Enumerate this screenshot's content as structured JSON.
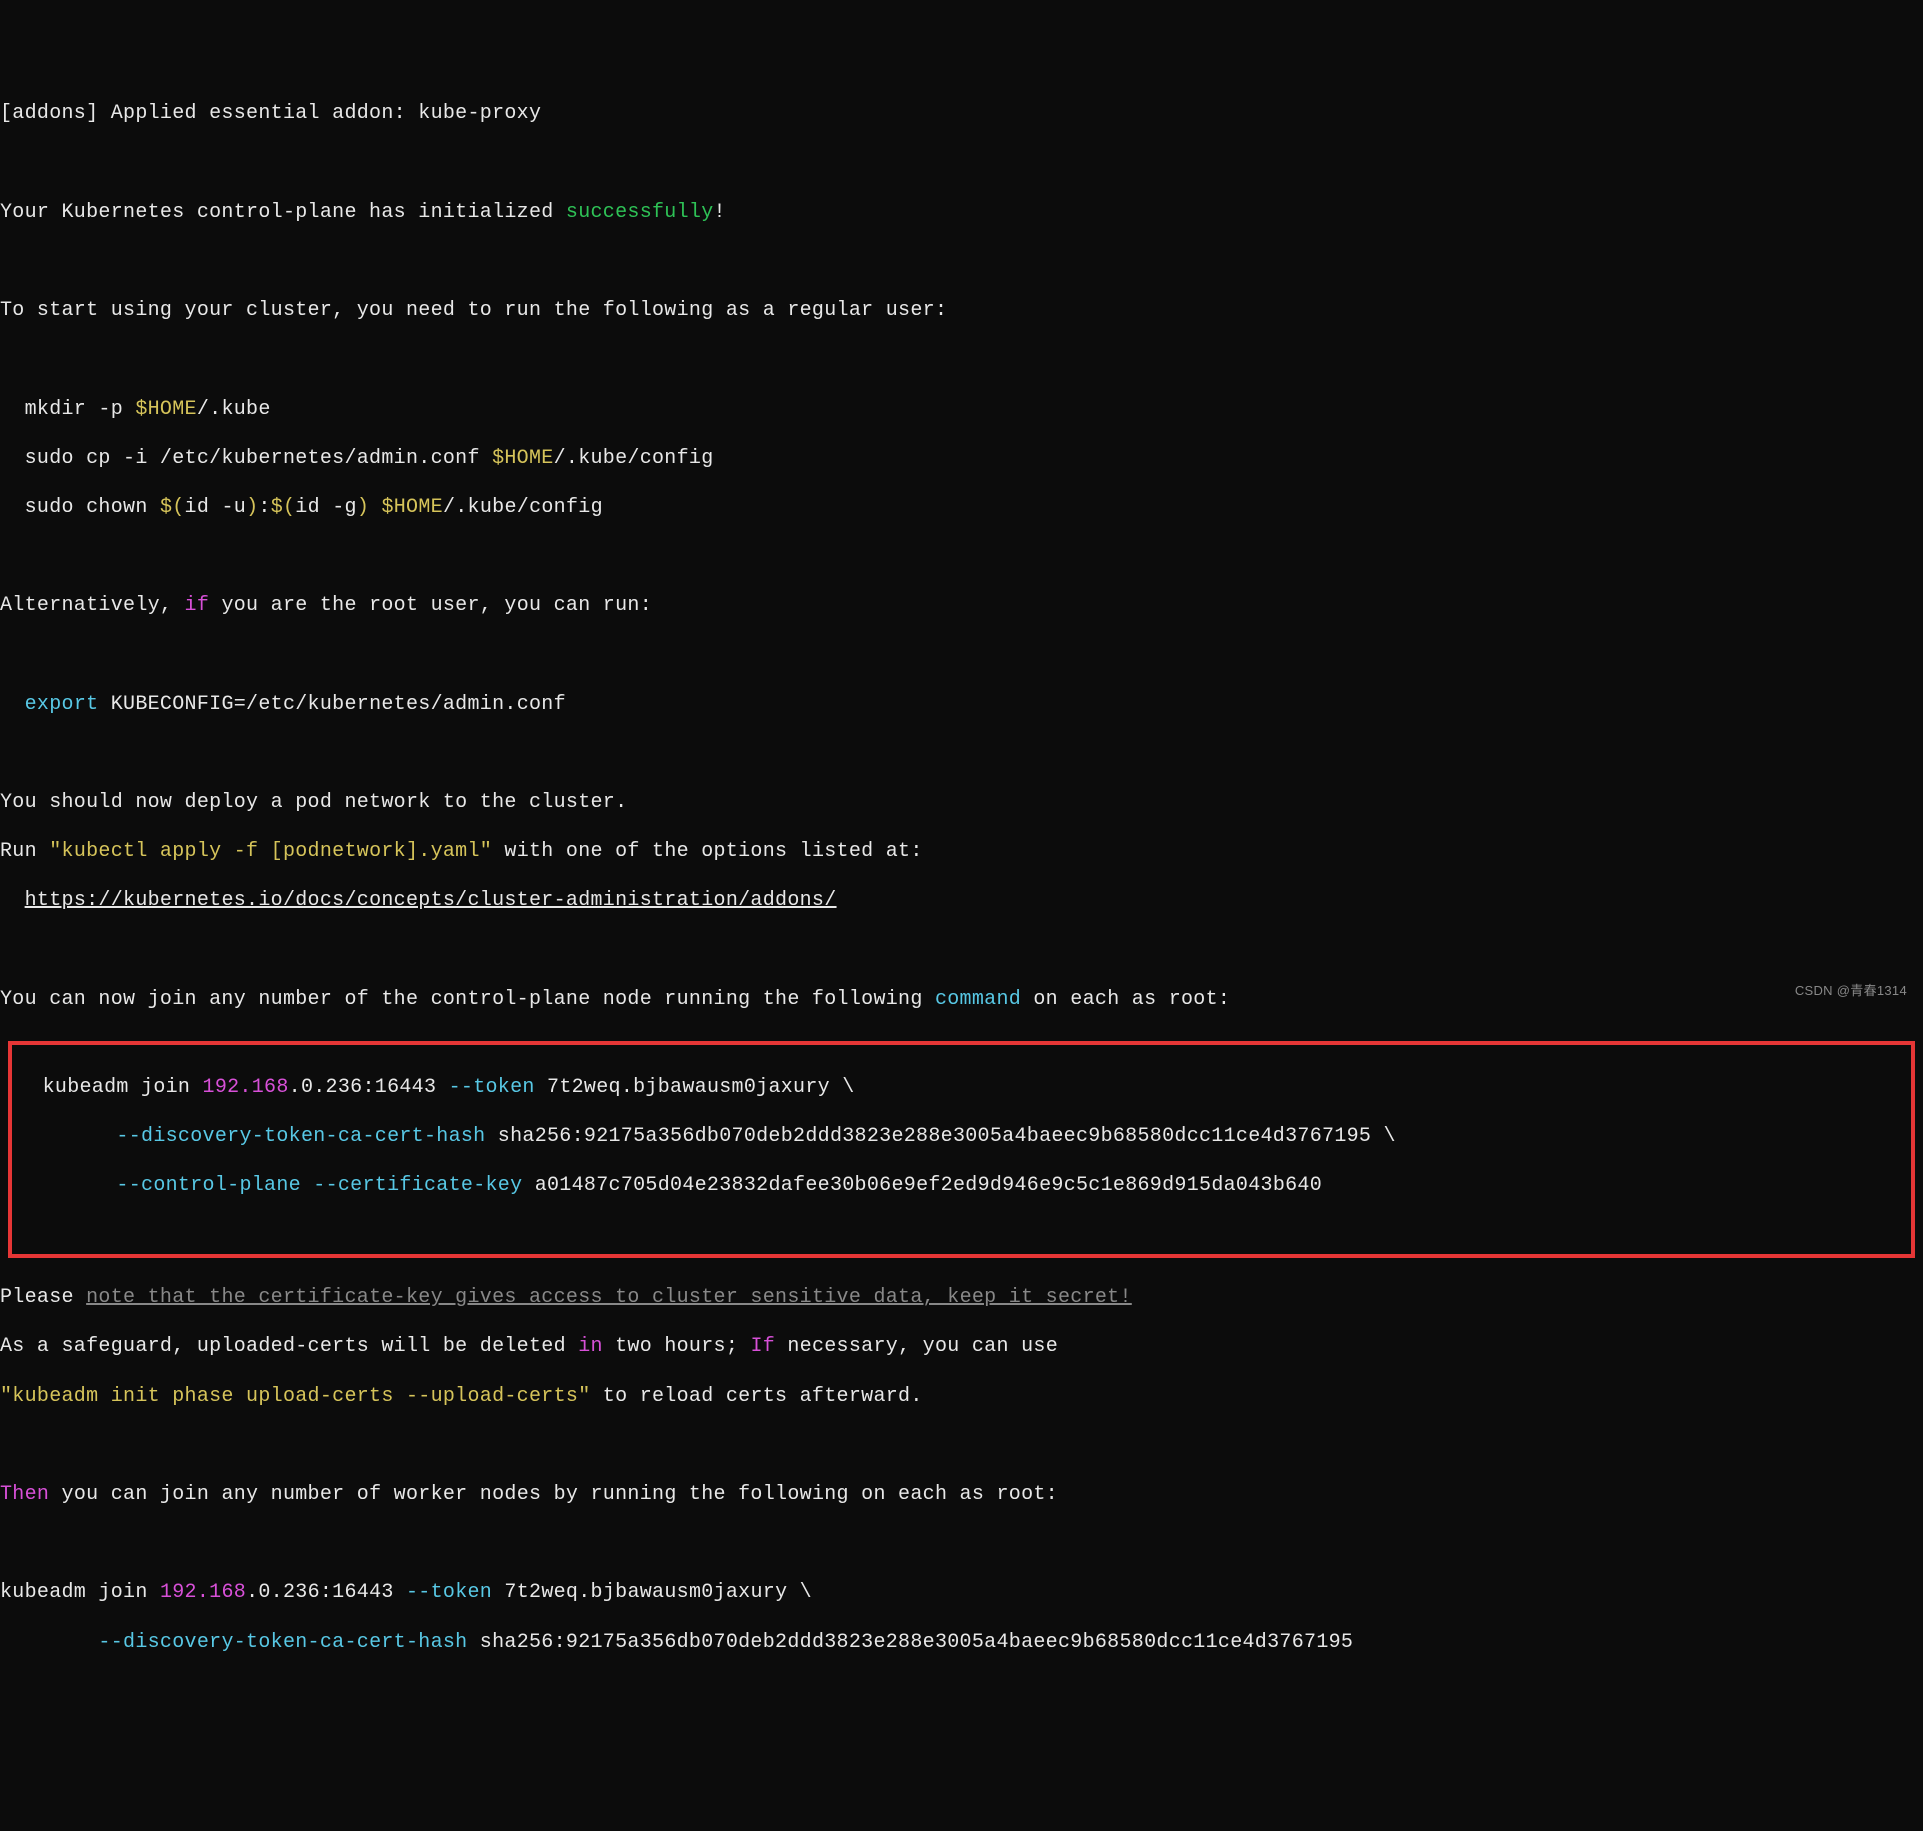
{
  "line1_a": "[addons] Applied essential addon: kube-proxy",
  "line3_a": "Your Kubernetes control-plane has initialized ",
  "line3_b": "successfully",
  "line3_c": "!",
  "line5_a": "To start using your cluster, you need to run the following as a regular user:",
  "line7_a": "  mkdir -p ",
  "line7_b": "$HOME",
  "line7_c": "/.kube",
  "line8_a": "  sudo cp -i /etc/kubernetes/admin.conf ",
  "line8_b": "$HOME",
  "line8_c": "/.kube/config",
  "line9_a": "  sudo chown ",
  "line9_b": "$(",
  "line9_c": "id -u",
  "line9_d": ")",
  "line9_e": ":",
  "line9_f": "$(",
  "line9_g": "id -g",
  "line9_h": ")",
  "line9_i": " ",
  "line9_j": "$HOME",
  "line9_k": "/.kube/config",
  "line11_a": "Alternatively, ",
  "line11_b": "if",
  "line11_c": " you are the root user, you can run:",
  "line13_a": "  ",
  "line13_b": "export",
  "line13_c": " KUBECONFIG=/etc/kubernetes/admin.conf",
  "line15_a": "You should now deploy a pod network to the cluster.",
  "line16_a": "Run ",
  "line16_b": "\"kubectl apply -f [podnetwork].yaml\"",
  "line16_c": " with one of the options listed at:",
  "line17_a": "  ",
  "line17_b": "https://kubernetes.io/docs/concepts/cluster-administration/addons/",
  "line19_a": "You can now join any number of the control-plane node running the following ",
  "line19_b": "command",
  "line19_c": " on each as root:",
  "box_l1_a": "  kubeadm join ",
  "box_l1_b": "192.168",
  "box_l1_c": ".0.236:16443 ",
  "box_l1_d": "--token",
  "box_l1_e": " 7t2weq.bjbawausm0jaxury \\",
  "box_l2_a": "        ",
  "box_l2_b": "--discovery-token-ca-cert-hash",
  "box_l2_c": " sha256:92175a356db070deb2ddd3823e288e3005a4baeec9b68580dcc11ce4d3767195 \\",
  "box_l3_a": "        ",
  "box_l3_b": "--control-plane",
  "box_l3_c": " ",
  "box_l3_d": "--certificate-key",
  "box_l3_e": " a01487c705d04e23832dafee30b06e9ef2ed9d946e9c5c1e869d915da043b640",
  "line22_a": "Please ",
  "line22_b": "note that the certificate-key gives access to cluster sensitive data, keep it secret!",
  "line23_a": "As a safeguard, uploaded-certs will be deleted ",
  "line23_b": "in",
  "line23_c": " two hours; ",
  "line23_d": "If",
  "line23_e": " necessary, you can use",
  "line24_a": "\"kubeadm init phase upload-certs --upload-certs\"",
  "line24_b": " to reload certs afterward.",
  "line26_a": "Then",
  "line26_b": " you can join any number of worker nodes by running the following on each as root:",
  "line28_a": "kubeadm join ",
  "line28_b": "192.168",
  "line28_c": ".0.236:16443 ",
  "line28_d": "--token",
  "line28_e": " 7t2weq.bjbawausm0jaxury \\",
  "line29_a": "        ",
  "line29_b": "--discovery-token-ca-cert-hash",
  "line29_c": " sha256:92175a356db070deb2ddd3823e288e3005a4baeec9b68580dcc11ce4d3767195",
  "watermark": "CSDN @青春1314"
}
